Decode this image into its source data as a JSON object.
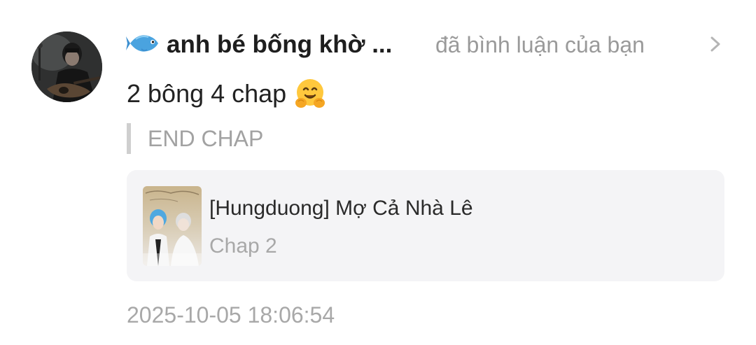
{
  "notification": {
    "user": {
      "name": "anh bé bống khờ ...",
      "avatar_icon": "guitar-player-avatar",
      "badge_icon": "fish-icon"
    },
    "action_text": "đã bình luận của bạn",
    "chevron_icon": "chevron-right-icon",
    "comment_text": "2 bông 4 chap",
    "comment_emoji": "hugging-face-icon",
    "quoted_text": "END CHAP",
    "story": {
      "title": "[Hungduong] Mợ Cả Nhà Lê",
      "chapter": "Chap 2",
      "cover_icon": "story-cover"
    },
    "timestamp": "2025-10-05 18:06:54"
  },
  "colors": {
    "card_background": "#f4f4f6",
    "muted_text": "#a8a8a8",
    "quote_bar": "#cfcfcf",
    "fish_blue": "#4aa3df"
  }
}
